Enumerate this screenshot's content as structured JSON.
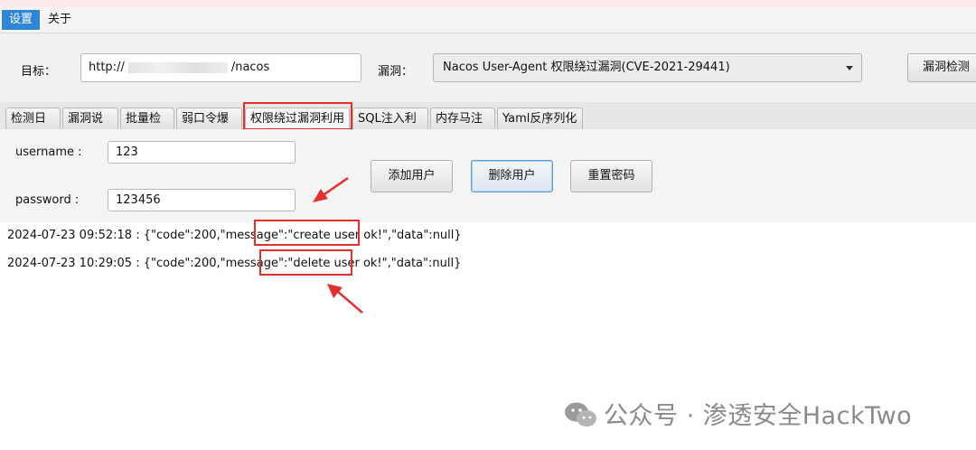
{
  "menu": {
    "settings": "设置",
    "about": "关于"
  },
  "target": {
    "label": "目标：",
    "value_prefix": "http://",
    "value_suffix": "/nacos"
  },
  "vuln": {
    "label": "漏洞：",
    "selected": "Nacos User-Agent 权限绕过漏洞(CVE-2021-29441)"
  },
  "detect_button": "漏洞检测",
  "tabs": [
    "检测日志",
    "漏洞说明",
    "批量检测",
    "弱口令爆破",
    "权限绕过漏洞利用",
    "SQL注入利用",
    "内存马注入",
    "Yaml反序列化"
  ],
  "form": {
    "username_label": "username :",
    "username_value": "123",
    "password_label": "password :",
    "password_value": "123456"
  },
  "actions": {
    "add_user": "添加用户",
    "delete_user": "删除用户",
    "reset_password": "重置密码"
  },
  "log": [
    {
      "ts_prefix": "2024-07-23 09:52:18 : {\"code\":200,\"message\":",
      "highlight": "\"create user ok!\"",
      "suffix": ",\"data\":null}"
    },
    {
      "ts_prefix": "2024-07-23 10:29:05 : {\"code\":200,\"message\":",
      "highlight": "\"delete user ok!\"",
      "suffix": ",\"data\":null}"
    }
  ],
  "watermark": "公众号 · 渗透安全HackTwo",
  "colors": {
    "accent": "#2f86d6",
    "annotation_red": "#e2312c"
  }
}
